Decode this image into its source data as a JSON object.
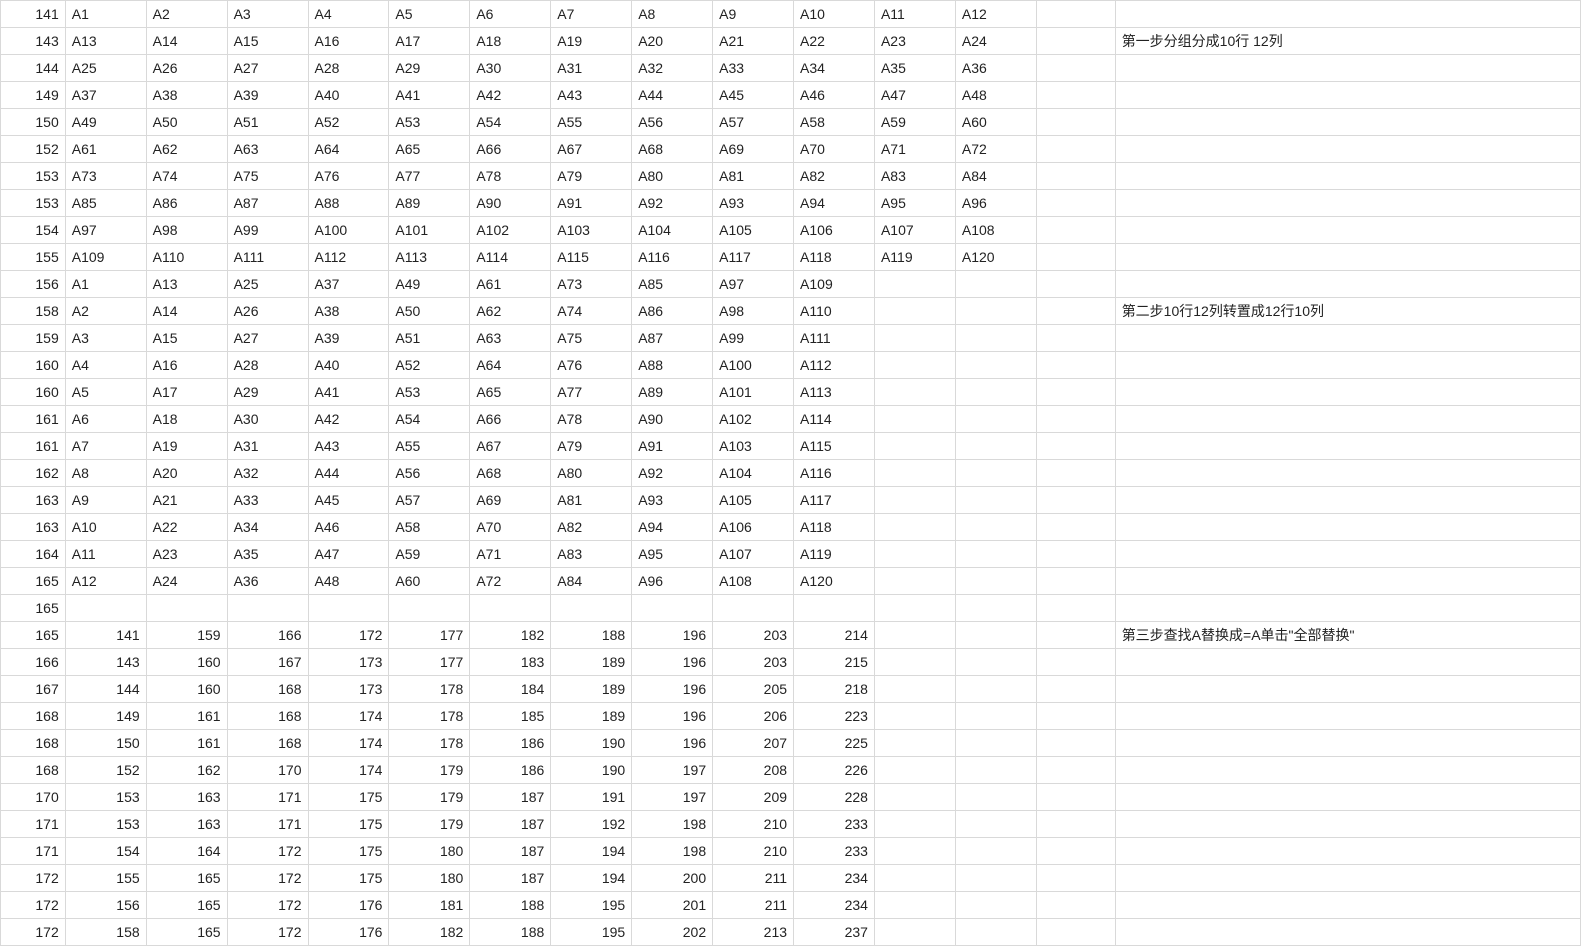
{
  "notes": {
    "step1": "第一步分组分成10行 12列",
    "step2": "第二步10行12列转置成12行10列",
    "step3": "第三步查找A替换成=A单击\"全部替换\""
  },
  "section1_num_col": [
    141,
    143,
    144,
    149,
    150,
    152,
    153,
    153,
    154,
    155
  ],
  "section2_num_col": [
    156,
    158,
    159,
    160,
    160,
    161,
    161,
    162,
    163,
    163,
    164,
    165
  ],
  "blank_row_num": 165,
  "section3_num_col": [
    165,
    166,
    167,
    168,
    168,
    168,
    170,
    171,
    171,
    172,
    172,
    172
  ],
  "chart_data": {
    "type": "table",
    "section1": {
      "description": "10 rows × 12 cols of labels A1..A120 row-major",
      "rows": [
        [
          "A1",
          "A2",
          "A3",
          "A4",
          "A5",
          "A6",
          "A7",
          "A8",
          "A9",
          "A10",
          "A11",
          "A12"
        ],
        [
          "A13",
          "A14",
          "A15",
          "A16",
          "A17",
          "A18",
          "A19",
          "A20",
          "A21",
          "A22",
          "A23",
          "A24"
        ],
        [
          "A25",
          "A26",
          "A27",
          "A28",
          "A29",
          "A30",
          "A31",
          "A32",
          "A33",
          "A34",
          "A35",
          "A36"
        ],
        [
          "A37",
          "A38",
          "A39",
          "A40",
          "A41",
          "A42",
          "A43",
          "A44",
          "A45",
          "A46",
          "A47",
          "A48"
        ],
        [
          "A49",
          "A50",
          "A51",
          "A52",
          "A53",
          "A54",
          "A55",
          "A56",
          "A57",
          "A58",
          "A59",
          "A60"
        ],
        [
          "A61",
          "A62",
          "A63",
          "A64",
          "A65",
          "A66",
          "A67",
          "A68",
          "A69",
          "A70",
          "A71",
          "A72"
        ],
        [
          "A73",
          "A74",
          "A75",
          "A76",
          "A77",
          "A78",
          "A79",
          "A80",
          "A81",
          "A82",
          "A83",
          "A84"
        ],
        [
          "A85",
          "A86",
          "A87",
          "A88",
          "A89",
          "A90",
          "A91",
          "A92",
          "A93",
          "A94",
          "A95",
          "A96"
        ],
        [
          "A97",
          "A98",
          "A99",
          "A100",
          "A101",
          "A102",
          "A103",
          "A104",
          "A105",
          "A106",
          "A107",
          "A108"
        ],
        [
          "A109",
          "A110",
          "A111",
          "A112",
          "A113",
          "A114",
          "A115",
          "A116",
          "A117",
          "A118",
          "A119",
          "A120"
        ]
      ]
    },
    "section2": {
      "description": "Transpose: 12 rows × 10 cols",
      "rows": [
        [
          "A1",
          "A13",
          "A25",
          "A37",
          "A49",
          "A61",
          "A73",
          "A85",
          "A97",
          "A109"
        ],
        [
          "A2",
          "A14",
          "A26",
          "A38",
          "A50",
          "A62",
          "A74",
          "A86",
          "A98",
          "A110"
        ],
        [
          "A3",
          "A15",
          "A27",
          "A39",
          "A51",
          "A63",
          "A75",
          "A87",
          "A99",
          "A111"
        ],
        [
          "A4",
          "A16",
          "A28",
          "A40",
          "A52",
          "A64",
          "A76",
          "A88",
          "A100",
          "A112"
        ],
        [
          "A5",
          "A17",
          "A29",
          "A41",
          "A53",
          "A65",
          "A77",
          "A89",
          "A101",
          "A113"
        ],
        [
          "A6",
          "A18",
          "A30",
          "A42",
          "A54",
          "A66",
          "A78",
          "A90",
          "A102",
          "A114"
        ],
        [
          "A7",
          "A19",
          "A31",
          "A43",
          "A55",
          "A67",
          "A79",
          "A91",
          "A103",
          "A115"
        ],
        [
          "A8",
          "A20",
          "A32",
          "A44",
          "A56",
          "A68",
          "A80",
          "A92",
          "A104",
          "A116"
        ],
        [
          "A9",
          "A21",
          "A33",
          "A45",
          "A57",
          "A69",
          "A81",
          "A93",
          "A105",
          "A117"
        ],
        [
          "A10",
          "A22",
          "A34",
          "A46",
          "A58",
          "A70",
          "A82",
          "A94",
          "A106",
          "A118"
        ],
        [
          "A11",
          "A23",
          "A35",
          "A47",
          "A59",
          "A71",
          "A83",
          "A95",
          "A107",
          "A119"
        ],
        [
          "A12",
          "A24",
          "A36",
          "A48",
          "A60",
          "A72",
          "A84",
          "A96",
          "A108",
          "A120"
        ]
      ]
    },
    "section3": {
      "description": "Numeric result 12 rows × 10 cols (right-aligned)",
      "rows": [
        [
          141,
          159,
          166,
          172,
          177,
          182,
          188,
          196,
          203,
          214
        ],
        [
          143,
          160,
          167,
          173,
          177,
          183,
          189,
          196,
          203,
          215
        ],
        [
          144,
          160,
          168,
          173,
          178,
          184,
          189,
          196,
          205,
          218
        ],
        [
          149,
          161,
          168,
          174,
          178,
          185,
          189,
          196,
          206,
          223
        ],
        [
          150,
          161,
          168,
          174,
          178,
          186,
          190,
          196,
          207,
          225
        ],
        [
          152,
          162,
          170,
          174,
          179,
          186,
          190,
          197,
          208,
          226
        ],
        [
          153,
          163,
          171,
          175,
          179,
          187,
          191,
          197,
          209,
          228
        ],
        [
          153,
          163,
          171,
          175,
          179,
          187,
          192,
          198,
          210,
          233
        ],
        [
          154,
          164,
          172,
          175,
          180,
          187,
          194,
          198,
          210,
          233
        ],
        [
          155,
          165,
          172,
          175,
          180,
          187,
          194,
          200,
          211,
          234
        ],
        [
          156,
          165,
          172,
          176,
          181,
          188,
          195,
          201,
          211,
          234
        ],
        [
          158,
          165,
          172,
          176,
          182,
          188,
          195,
          202,
          213,
          237
        ]
      ]
    }
  }
}
